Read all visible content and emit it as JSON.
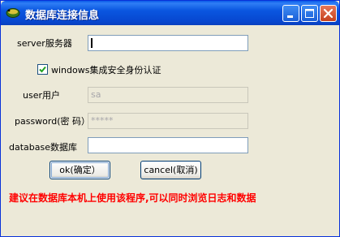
{
  "window": {
    "title": "数据库连接信息",
    "controls": [
      "minimize-icon",
      "maximize-icon",
      "close-icon"
    ],
    "title_color": "#0a56e0"
  },
  "form": {
    "server_label": "server服务器",
    "server_value": "",
    "windows_auth_label": "windows集成安全身份认证",
    "windows_auth_checked": true,
    "user_label": "user用户",
    "user_value": "sa",
    "password_label": "password(密 码）",
    "password_value": "*****",
    "database_label": "database数据库",
    "database_value": ""
  },
  "buttons": {
    "ok": "ok(确定）",
    "cancel": "cancel(取消)"
  },
  "notice": {
    "text": "建议在数据库本机上使用该程序,可以同时浏览日志和数据",
    "color": "#ff0000"
  }
}
